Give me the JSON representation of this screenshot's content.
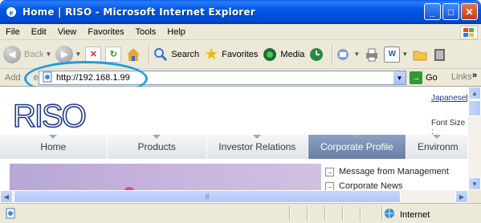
{
  "window": {
    "title": "Home | RISO - Microsoft Internet Explorer",
    "buttons": {
      "minimize": "_",
      "maximize": "□",
      "close": "✕"
    }
  },
  "menu": [
    "File",
    "Edit",
    "View",
    "Favorites",
    "Tools",
    "Help"
  ],
  "toolbar": {
    "back": "Back",
    "search": "Search",
    "favorites": "Favorites",
    "media": "Media"
  },
  "address": {
    "label": "Address",
    "label_visible": "Add",
    "label_tail": "ess",
    "url": "http://192.168.1.99",
    "go": "Go",
    "links": "Links"
  },
  "page": {
    "logo": "RISO",
    "lang_link": "Japanese",
    "lang_sep": "|",
    "font_size_label": "Font Size :",
    "nav": [
      "Home",
      "Products",
      "Investor Relations",
      "Corporate Profile",
      "Environm"
    ],
    "nav_active_index": 3,
    "side_links": [
      "Message from Management",
      "Corporate News"
    ]
  },
  "status": {
    "zone": "Internet"
  },
  "colors": {
    "title_bar": "#0054e3",
    "highlight_oval": "#1e9ee0",
    "nav_active": "#7a8db3",
    "logo": "#1f3a8c"
  }
}
